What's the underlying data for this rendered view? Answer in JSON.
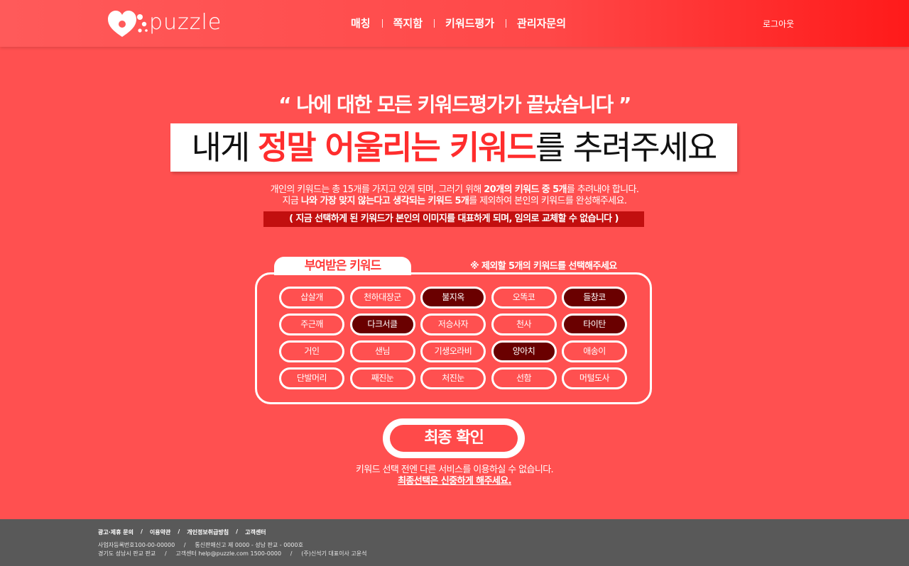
{
  "header": {
    "logo_text": "puzzle",
    "nav": [
      "매칭",
      "쪽지함",
      "키워드평가",
      "관리자문의"
    ],
    "logout": "로그아웃"
  },
  "main": {
    "headline": "“ 나에 대한 모든 키워드평가가 끝났습니다 ”",
    "banner": {
      "pre": "내게 ",
      "hl": "정말 어울리는 키워드",
      "post": "를 추려주세요"
    },
    "desc1": {
      "a": "개인의 키워드는 총 15개를 가지고 있게 되며, 그러기 위해 ",
      "b": "20개의 키워드 중 5개",
      "c": "를 추려내야 합니다."
    },
    "desc2": {
      "a": "지금 ",
      "b": "나와 가장 맞지 않는다고 생각되는 키워드 5개",
      "c": "를 제외하여 본인의 키워드를 완성해주세요."
    },
    "notice": "( 지금 선택하게 된 키워드가 본인의 이미지를 대표하게 되며, 임의로 교체할 수 없습니다 )",
    "box_tab": "부여받은 키워드",
    "box_hint": "※ 제외할 5개의 키워드를 선택해주세요",
    "keywords": [
      {
        "label": "삽살개",
        "selected": false
      },
      {
        "label": "천하대장군",
        "selected": false
      },
      {
        "label": "불지옥",
        "selected": true
      },
      {
        "label": "오똑코",
        "selected": false
      },
      {
        "label": "들창코",
        "selected": true
      },
      {
        "label": "주근깨",
        "selected": false
      },
      {
        "label": "다크서클",
        "selected": true
      },
      {
        "label": "저승사자",
        "selected": false
      },
      {
        "label": "천사",
        "selected": false
      },
      {
        "label": "타이탄",
        "selected": true
      },
      {
        "label": "거인",
        "selected": false
      },
      {
        "label": "샌님",
        "selected": false
      },
      {
        "label": "기생오라비",
        "selected": false
      },
      {
        "label": "양아치",
        "selected": true
      },
      {
        "label": "애송이",
        "selected": false
      },
      {
        "label": "단발머리",
        "selected": false
      },
      {
        "label": "째진눈",
        "selected": false
      },
      {
        "label": "처진눈",
        "selected": false
      },
      {
        "label": "선함",
        "selected": false
      },
      {
        "label": "머털도사",
        "selected": false
      }
    ],
    "confirm": "최종 확인",
    "foot_note1": "키워드 선택 전엔 다른 서비스를 이용하실 수 없습니다.",
    "foot_note2": "최종선택은 신중하게 해주세요."
  },
  "footer": {
    "links": [
      "광고·제휴 문의",
      "이용약관",
      "개인정보취급방침",
      "고객센터"
    ],
    "sep": "/",
    "info1": "사업자등록번호100-00-00000     /     통신판매신고 제 0000 - 성남 판교 - 0000호",
    "info2": "경기도 성남시 판교 판교     /     고객센터 help@puzzle.com 1500-0000     /     (주)신석기 대표이사 고윤석"
  },
  "colors": {
    "background": "#ff5050",
    "header_start": "#ff5a5a",
    "header_end": "#ff1a1a",
    "highlight": "#ff2d2d",
    "notice_bg": "#c20f0f",
    "selected_keyword": "#6a0000",
    "footer_bg": "#595959"
  }
}
